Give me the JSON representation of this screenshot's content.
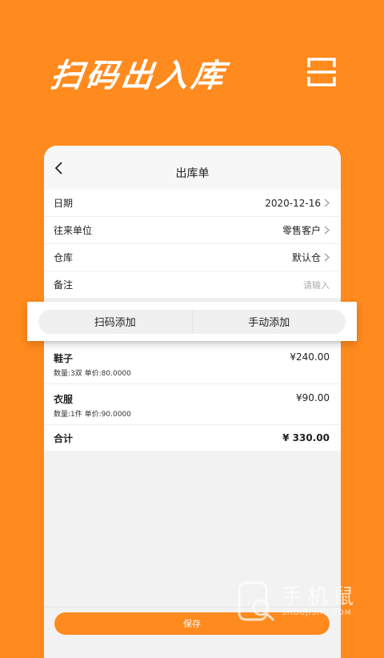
{
  "hero": {
    "title": "扫码出入库"
  },
  "nav": {
    "title": "出库单"
  },
  "form": [
    {
      "label": "日期",
      "value": "2020-12-16"
    },
    {
      "label": "往来单位",
      "value": "零售客户"
    },
    {
      "label": "仓库",
      "value": "默认仓"
    },
    {
      "label": "备注",
      "placeholder": "请输入"
    }
  ],
  "actions": {
    "scan_add": "扫码添加",
    "manual_add": "手动添加"
  },
  "items": [
    {
      "name": "鞋子",
      "detail": "数量:3双 单价:80.0000",
      "price": "¥240.00"
    },
    {
      "name": "衣服",
      "detail": "数量:1件 单价:90.0000",
      "price": "¥90.00"
    }
  ],
  "total": {
    "label": "合计",
    "value": "¥ 330.00"
  },
  "save": {
    "label": "保存"
  },
  "watermark": {
    "text": "手机鼠",
    "sub": "SHOUJISHU.COM"
  },
  "colors": {
    "accent": "#FF8A1E",
    "background": "#F2F2F2"
  }
}
